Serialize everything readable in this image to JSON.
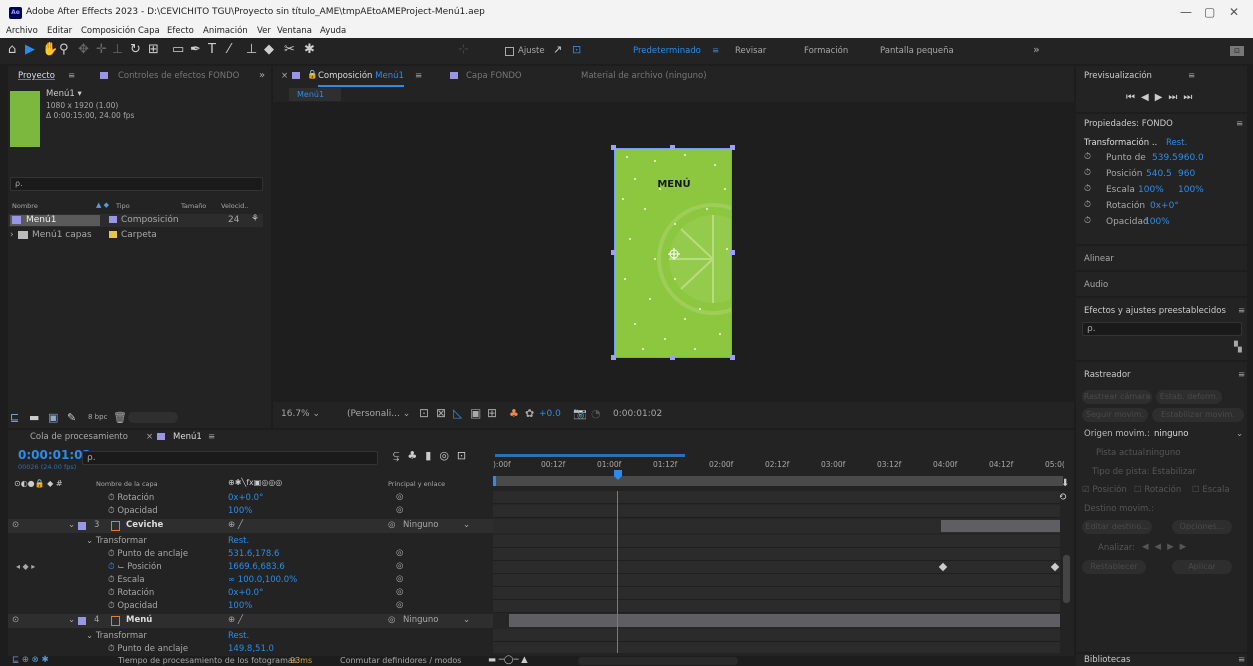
{
  "window": {
    "title": "Adobe After Effects 2023 - D:\\CEVICHITO TGU\\Proyecto sin título_AME\\tmpAEtoAMEProject-Menú1.aep",
    "app_icon": "Ae",
    "minimize": "—",
    "maximize": "▢",
    "close": "✕"
  },
  "menu": [
    "Archivo",
    "Editar",
    "Composición",
    "Capa",
    "Efecto",
    "Animación",
    "Ver",
    "Ventana",
    "Ayuda"
  ],
  "toolbar": {
    "snap_label": "Ajuste",
    "workspaces": [
      "Predeterminado",
      "Revisar",
      "Formación",
      "Pantalla pequeña"
    ],
    "more": "»"
  },
  "project_panel": {
    "tab_project": "Proyecto",
    "tab_effects": "Controles de efectos FONDO",
    "comp_name": "Menú1 ▾",
    "comp_size": "1080 x 1920 (1.00)",
    "comp_duration": "Δ 0:00:15:00, 24.00 fps",
    "search_placeholder": "ρ.",
    "columns": [
      "Nombre",
      "Tipo",
      "Tamaño",
      "Velocid.."
    ],
    "items": [
      {
        "name": "Menú1",
        "type": "Composición",
        "size": "24"
      },
      {
        "name": "Menú1 capas",
        "type": "Carpeta",
        "size": ""
      }
    ],
    "bpc": "8 bpc"
  },
  "comp_panel": {
    "tab_comp_prefix": "Composición",
    "tab_comp_name": "Menú1",
    "tab_layer": "Capa FONDO",
    "tab_footage": "Material de archivo (ninguno)",
    "breadcrumb": "Menú1",
    "artwork_title": "MENÚ",
    "zoom": "16.7%",
    "resolution": "(Personali...",
    "exposure": "+0.0",
    "timecode": "0:00:01:02"
  },
  "right_panel": {
    "preview": "Previsualización",
    "properties": "Propiedades: FONDO",
    "transform": "Transformación ..",
    "transform_reset": "Rest.",
    "props": [
      {
        "label": "Punto de",
        "val1": "539.5",
        "val2": "960.0"
      },
      {
        "label": "Posición",
        "val1": "540.5",
        "val2": "960"
      },
      {
        "label": "Escala",
        "val1": "100%",
        "val2": "100%"
      },
      {
        "label": "Rotación",
        "val1": "0x+0°",
        "val2": ""
      },
      {
        "label": "Opacidad",
        "val1": "100%",
        "val2": ""
      }
    ],
    "align": "Alinear",
    "audio": "Audio",
    "effects": "Efectos y ajustes preestablecidos",
    "tracker": "Rastreador",
    "track_camera": "Rastrear cámara",
    "warp": "Estab. deform.",
    "track_motion": "Seguir movim.",
    "stabilize": "Estabilizar movim.",
    "motion_source_label": "Origen movim.:",
    "motion_source": "ninguno",
    "current_track_label": "Pista actual:",
    "current_track": "ninguno",
    "track_type_label": "Tipo de pista:",
    "track_type": "Estabilizar",
    "chk_position": "Posición",
    "chk_rotation": "Rotación",
    "chk_scale": "Escala",
    "motion_target": "Destino movim.:",
    "edit_target": "Editar destino...",
    "options": "Opciones...",
    "analyze": "Analizar:",
    "reset": "Restablecer",
    "apply": "Aplicar",
    "libraries": "Bibliotecas"
  },
  "timeline": {
    "tab_render": "Cola de procesamiento",
    "tab_comp": "Menú1",
    "timecode": "0:00:01:02",
    "frames": "00026 (24.00 fps)",
    "col_layer": "Nombre de la capa",
    "col_parent": "Principal y enlace",
    "ruler": [
      "):00f",
      "00:12f",
      "01:00f",
      "01:12f",
      "02:00f",
      "02:12f",
      "03:00f",
      "03:12f",
      "04:00f",
      "04:12f",
      "05:0("
    ],
    "rows": [
      {
        "kind": "prop",
        "name": "Rotación",
        "value": "0x+0.0°"
      },
      {
        "kind": "prop",
        "name": "Opacidad",
        "value": "100%"
      },
      {
        "kind": "layer",
        "num": "3",
        "name": "Ceviche",
        "parent": "Ninguno"
      },
      {
        "kind": "group",
        "name": "Transformar",
        "value": "Rest."
      },
      {
        "kind": "prop",
        "name": "Punto de anclaje",
        "value": "531.6,178.6"
      },
      {
        "kind": "propkf",
        "name": "Posición",
        "value": "1669.6,683.6"
      },
      {
        "kind": "prop",
        "name": "Escala",
        "value": "∞ 100.0,100.0%"
      },
      {
        "kind": "prop",
        "name": "Rotación",
        "value": "0x+0.0°"
      },
      {
        "kind": "prop",
        "name": "Opacidad",
        "value": "100%"
      },
      {
        "kind": "layer",
        "num": "4",
        "name": "Menú",
        "parent": "Ninguno"
      },
      {
        "kind": "group",
        "name": "Transformar",
        "value": "Rest."
      },
      {
        "kind": "prop",
        "name": "Punto de anclaje",
        "value": "149.8,51.0"
      }
    ],
    "footer_render": "Tiempo de procesamiento de los fotogramas:",
    "footer_ms": "93ms",
    "footer_switch": "Conmutar definidores / modos"
  },
  "colors": {
    "accent": "#2d8ceb",
    "lime": "#8dc63f",
    "panel": "#232323",
    "bg": "#1d1d1d"
  }
}
